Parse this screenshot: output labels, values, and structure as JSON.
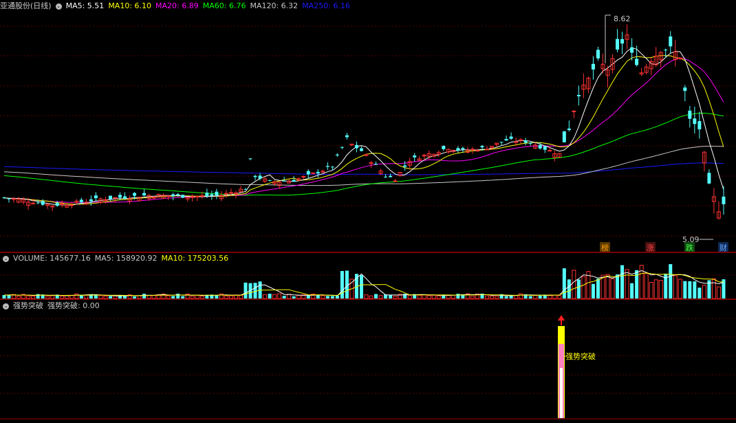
{
  "header": {
    "title": "亚通股份(日线)",
    "ma": [
      {
        "label": "MA5: 5.51",
        "color": "#ffffff"
      },
      {
        "label": "MA10: 6.10",
        "color": "#ffff00"
      },
      {
        "label": "MA20: 6.89",
        "color": "#ff00ff"
      },
      {
        "label": "MA60: 6.76",
        "color": "#00ff00"
      },
      {
        "label": "MA120: 6.32",
        "color": "#c8c8c8"
      },
      {
        "label": "MA250: 6.16",
        "color": "#1a1aff"
      }
    ]
  },
  "volume_header": [
    {
      "label": "VOLUME: 145677.16",
      "color": "#c8c8c8"
    },
    {
      "label": "MA5: 158920.92",
      "color": "#c8c8c8"
    },
    {
      "label": "MA10: 175203.56",
      "color": "#ffff00"
    }
  ],
  "indicator_header": [
    {
      "label": "强势突破",
      "color": "#c8c8c8"
    },
    {
      "label": "强势突破: 0.00",
      "color": "#c8c8c8"
    }
  ],
  "annotations": {
    "max_price": "8.62",
    "min_price": "5.09",
    "signal_label": "强势突破"
  },
  "event_tags": [
    {
      "text": "榜",
      "color": "#ff9900",
      "bg": "#5a3a00"
    },
    {
      "text": "涨",
      "color": "#ff4444",
      "bg": "#4a1010"
    },
    {
      "text": "跌",
      "color": "#44ff44",
      "bg": "#104a10"
    },
    {
      "text": "财",
      "color": "#66aaff",
      "bg": "#102a5a"
    }
  ],
  "chart_data": {
    "type": "candlestick",
    "price_range": [
      5.09,
      8.62
    ],
    "last_close_approx": 5.5,
    "series": [
      {
        "name": "MA5",
        "last": 5.51
      },
      {
        "name": "MA10",
        "last": 6.1
      },
      {
        "name": "MA20",
        "last": 6.89
      },
      {
        "name": "MA60",
        "last": 6.76
      },
      {
        "name": "MA120",
        "last": 6.32
      },
      {
        "name": "MA250",
        "last": 6.16
      }
    ],
    "volume": {
      "last": 145677.16,
      "ma5": 158920.92,
      "ma10": 175203.56
    },
    "indicator": {
      "name": "强势突破",
      "last": 0.0
    }
  }
}
